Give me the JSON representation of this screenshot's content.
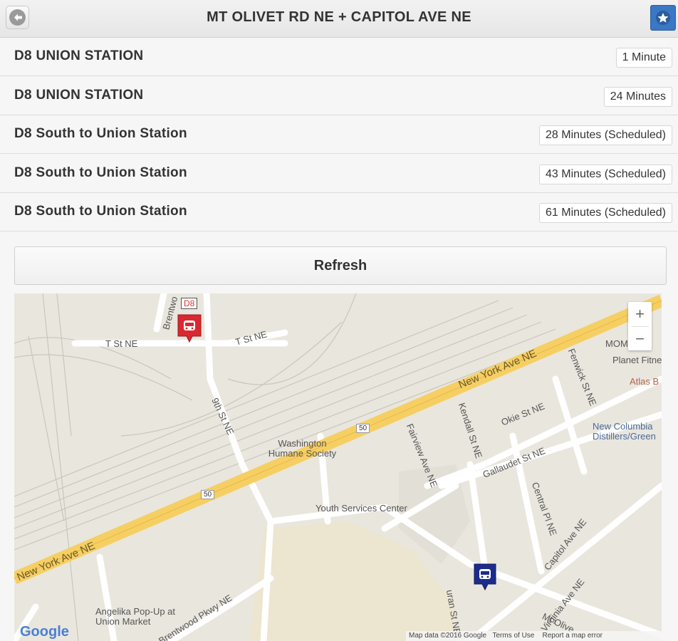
{
  "header": {
    "title": "MT OLIVET RD NE + CAPITOL AVE NE",
    "back_icon": "back-arrow-icon",
    "favorite_icon": "star-icon",
    "accent": "#3a77c4"
  },
  "arrivals": [
    {
      "route": "D8 UNION STATION",
      "time": "1 Minute"
    },
    {
      "route": "D8 UNION STATION",
      "time": "24 Minutes"
    },
    {
      "route": "D8 South to Union Station",
      "time": "28 Minutes (Scheduled)"
    },
    {
      "route": "D8 South to Union Station",
      "time": "43 Minutes (Scheduled)"
    },
    {
      "route": "D8 South to Union Station",
      "time": "61 Minutes (Scheduled)"
    }
  ],
  "refresh_label": "Refresh",
  "map": {
    "bus_label": "D8",
    "zoom_in": "+",
    "zoom_out": "−",
    "labels": {
      "t_st_w": "T St NE",
      "t_st_e": "T St NE",
      "brentwood": "Brentwo",
      "ninth_st": "9th St NE",
      "ny_ave": "New York Ave NE",
      "ny_ave_sw": "New York Ave NE",
      "fenwick": "Fenwick St NE",
      "kendall": "Kendall St NE",
      "okie": "Okie St NE",
      "fairview": "Fairview Ave NE",
      "gallaudet": "Gallaudet St NE",
      "central": "Central Pl NE",
      "capitol": "Capitol Ave NE",
      "virginia": "Virginia Ave NE",
      "brentwood_pkwy": "Brentwood Pkwy NE",
      "mt_olivet": "Mt Olive",
      "washington_humane": "Washington Humane Society",
      "youth_services": "Youth Services Center",
      "angelika": "Angelika Pop-Up at Union Market",
      "mom": "MOM",
      "planet_fitness": "Planet Fitne",
      "atlas": "Atlas B",
      "new_columbia": "New Columbia Distillers/Green",
      "route_50_a": "50",
      "route_50_b": "50",
      "vertical_st": "uran St NE"
    },
    "footer": {
      "data": "Map data ©2016 Google",
      "terms": "Terms of Use",
      "report": "Report a map error"
    },
    "google": "Google"
  }
}
